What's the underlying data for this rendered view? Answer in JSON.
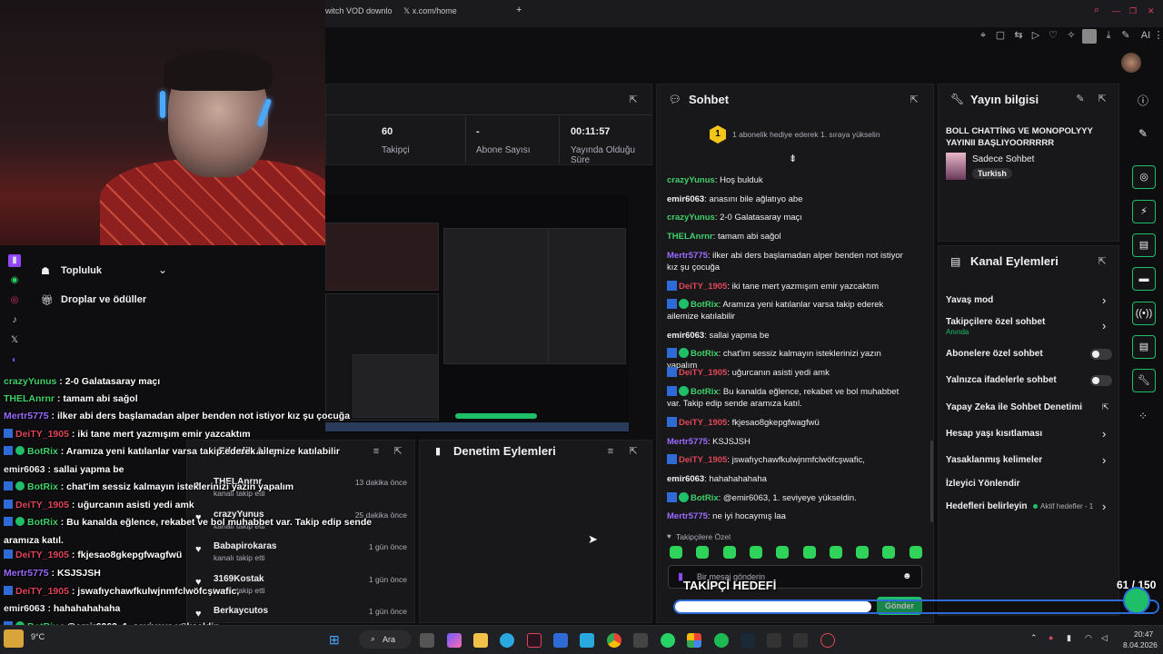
{
  "browser": {
    "tabs": [
      "witch VOD downlo",
      "x.com/home"
    ],
    "new_tab": "+",
    "toolbar_ai": "AI"
  },
  "stats": [
    {
      "value": "60",
      "label": "Takipçi"
    },
    {
      "value": "-",
      "label": "Abone Sayısı"
    },
    {
      "value": "00:11:57",
      "label": "Yayında Olduğu Süre"
    }
  ],
  "sidebar": {
    "items": [
      "Topluluk",
      "Droplar ve ödüller"
    ]
  },
  "chat": {
    "title": "Sohbet",
    "banner": "1 abonelik hediye ederek 1. sıraya yükselin",
    "banner_badge": "1",
    "messages": [
      {
        "name": "crazyYunus",
        "color": "#3fd26a",
        "text": "Hoş bulduk",
        "badges": ""
      },
      {
        "name": "emir6063",
        "color": "#efeff1",
        "text": "anasını bile ağlatıyo abe",
        "badges": ""
      },
      {
        "name": "crazyYunus",
        "color": "#3fd26a",
        "text": "2-0 Galatasaray maçı",
        "badges": ""
      },
      {
        "name": "THELAnrnr",
        "color": "#3fd26a",
        "text": "tamam abi sağol",
        "badges": ""
      },
      {
        "name": "Mertr5775",
        "color": "#9b6bff",
        "text": "ilker abi ders başlamadan alper benden not istiyor kız şu çocuğa",
        "badges": ""
      },
      {
        "name": "DeiTY_1905",
        "color": "#e0465a",
        "text": "iki tane mert yazmışım emir yazcaktım",
        "badges": "b"
      },
      {
        "name": "BotRix",
        "color": "#3fd26a",
        "text": "Aramıza yeni katılanlar varsa takip ederek ailemize katılabilir",
        "badges": "bc"
      },
      {
        "name": "emir6063",
        "color": "#efeff1",
        "text": "sallai yapma be",
        "badges": ""
      },
      {
        "name": "BotRix",
        "color": "#3fd26a",
        "text": "chat'im sessiz kalmayın isteklerinizi yazın yapalım",
        "badges": "bc"
      },
      {
        "name": "DeiTY_1905",
        "color": "#e0465a",
        "text": "uğurcanın asisti yedi amk",
        "badges": "b"
      },
      {
        "name": "BotRix",
        "color": "#3fd26a",
        "text": "Bu kanalda eğlence, rekabet ve bol muhabbet var. Takip edip sende aramıza katıl.",
        "badges": "bc"
      },
      {
        "name": "DeiTY_1905",
        "color": "#e0465a",
        "text": "fkjesao8gkepgfwagfwü",
        "badges": "b"
      },
      {
        "name": "Mertr5775",
        "color": "#9b6bff",
        "text": "KSJSJSH",
        "badges": ""
      },
      {
        "name": "DeiTY_1905",
        "color": "#e0465a",
        "text": "jswafıychawfkulwjnmfclwöfcşwafic,",
        "badges": "b"
      },
      {
        "name": "emir6063",
        "color": "#efeff1",
        "text": "hahahahahaha",
        "badges": ""
      },
      {
        "name": "BotRix",
        "color": "#3fd26a",
        "text": "@emir6063, 1. seviyeye yükseldin.",
        "badges": "bc"
      },
      {
        "name": "Mertr5775",
        "color": "#9b6bff",
        "text": "ne iyi hocaymış laa",
        "badges": ""
      }
    ],
    "followers_only": "Takipçilere Özel",
    "input_placeholder": "Bir mesaj gönderin",
    "send_label": "Gönder"
  },
  "stream_info": {
    "title": "Yayın bilgisi",
    "stream_title": "BOLL CHATTİNG VE MONOPOLYYY YAYINII BAŞLIYOORRRRR",
    "category": "Sadece Sohbet",
    "language": "Turkish"
  },
  "channel_actions": {
    "title": "Kanal Eylemleri",
    "items": [
      {
        "label": "Yavaş mod",
        "sub": "",
        "control": "chevron"
      },
      {
        "label": "Takipçilere özel sohbet",
        "sub": "Anında",
        "control": "chevron"
      },
      {
        "label": "Abonelere özel sohbet",
        "sub": "",
        "control": "toggle"
      },
      {
        "label": "Yalnızca ifadelerle sohbet",
        "sub": "",
        "control": "toggle"
      },
      {
        "label": "Yapay Zeka ile Sohbet Denetimi",
        "sub": "",
        "control": "external"
      },
      {
        "label": "Hesap yaşı kısıtlaması",
        "sub": "",
        "control": "chevron"
      },
      {
        "label": "Yasaklanmış kelimeler",
        "sub": "",
        "control": "chevron"
      },
      {
        "label": "İzleyici Yönlendir",
        "sub": "",
        "control": ""
      },
      {
        "label": "Hedefleri belirleyin",
        "sub": "",
        "control": "chevron",
        "extra": "Aktif hedefler - 1"
      }
    ]
  },
  "activity": {
    "title": "Etkinlik Akışı",
    "items": [
      {
        "name": "THELAnrnr",
        "sub": "kanalı takip etti",
        "time": "13 dakika önce"
      },
      {
        "name": "crazyYunus",
        "sub": "kanalı takip etti",
        "time": "25 dakika önce"
      },
      {
        "name": "Babapirokaras",
        "sub": "kanalı takip etti",
        "time": "1 gün önce"
      },
      {
        "name": "3169Kostak",
        "sub": "kanalı takip etti",
        "time": "1 gün önce"
      },
      {
        "name": "Berkaycutos",
        "sub": "",
        "time": "1 gün önce"
      }
    ]
  },
  "moderation": {
    "title": "Denetim Eylemleri"
  },
  "overlay_chat": [
    {
      "name": "crazyYunus",
      "color": "#3fd26a",
      "text": "2-0 Galatasaray maçı",
      "badges": ""
    },
    {
      "name": "THELAnrnr",
      "color": "#3fd26a",
      "text": "tamam abi sağol",
      "badges": ""
    },
    {
      "name": "Mertr5775",
      "color": "#9b6bff",
      "text": "ilker abi ders başlamadan alper benden not istiyor kız şu çocuğa",
      "badges": ""
    },
    {
      "name": "DeiTY_1905",
      "color": "#e0465a",
      "text": "iki tane mert yazmışım emir yazcaktım",
      "badges": "b"
    },
    {
      "name": "BotRix",
      "color": "#3fd26a",
      "text": "Aramıza yeni katılanlar varsa takip ederek ailemize katılabilir",
      "badges": "bc"
    },
    {
      "name": "emir6063",
      "color": "#efeff1",
      "text": "sallai yapma be",
      "badges": ""
    },
    {
      "name": "BotRix",
      "color": "#3fd26a",
      "text": "chat'im sessiz kalmayın isteklerinizi yazın yapalım",
      "badges": "bc"
    },
    {
      "name": "DeiTY_1905",
      "color": "#e0465a",
      "text": "uğurcanın asisti yedi amk",
      "badges": "b"
    },
    {
      "name": "BotRix",
      "color": "#3fd26a",
      "text": "Bu kanalda eğlence, rekabet ve bol muhabbet var. Takip edip sende",
      "badges": "bc"
    },
    {
      "name": "",
      "color": "#efeff1",
      "text": "aramıza katıl.",
      "badges": ""
    },
    {
      "name": "DeiTY_1905",
      "color": "#e0465a",
      "text": "fkjesao8gkepgfwagfwü",
      "badges": "b"
    },
    {
      "name": "Mertr5775",
      "color": "#9b6bff",
      "text": "KSJSJSH",
      "badges": ""
    },
    {
      "name": "DeiTY_1905",
      "color": "#e0465a",
      "text": "jswafıychawfkulwjnmfclwöfcşwafic,",
      "badges": "b"
    },
    {
      "name": "emir6063",
      "color": "#efeff1",
      "text": "hahahahahaha",
      "badges": ""
    },
    {
      "name": "BotRix",
      "color": "#3fd26a",
      "text": "@emir6063, 1. seviyeye yükseldin.",
      "badges": "bc"
    },
    {
      "name": "Mertr5775",
      "color": "#9b6bff",
      "text": "ne iyi hocaymış laa",
      "badges": ""
    }
  ],
  "goal": {
    "label": "TAKİPÇİ HEDEFİ",
    "count": "61 / 150",
    "progress": 0.4067
  },
  "taskbar": {
    "search": "Ara",
    "weather": "9°C",
    "time": "20:47",
    "date": "8.04.2026"
  },
  "colors": {
    "accent": "#1fbf6a",
    "panel": "#18181b",
    "background": "#0e0e10"
  }
}
